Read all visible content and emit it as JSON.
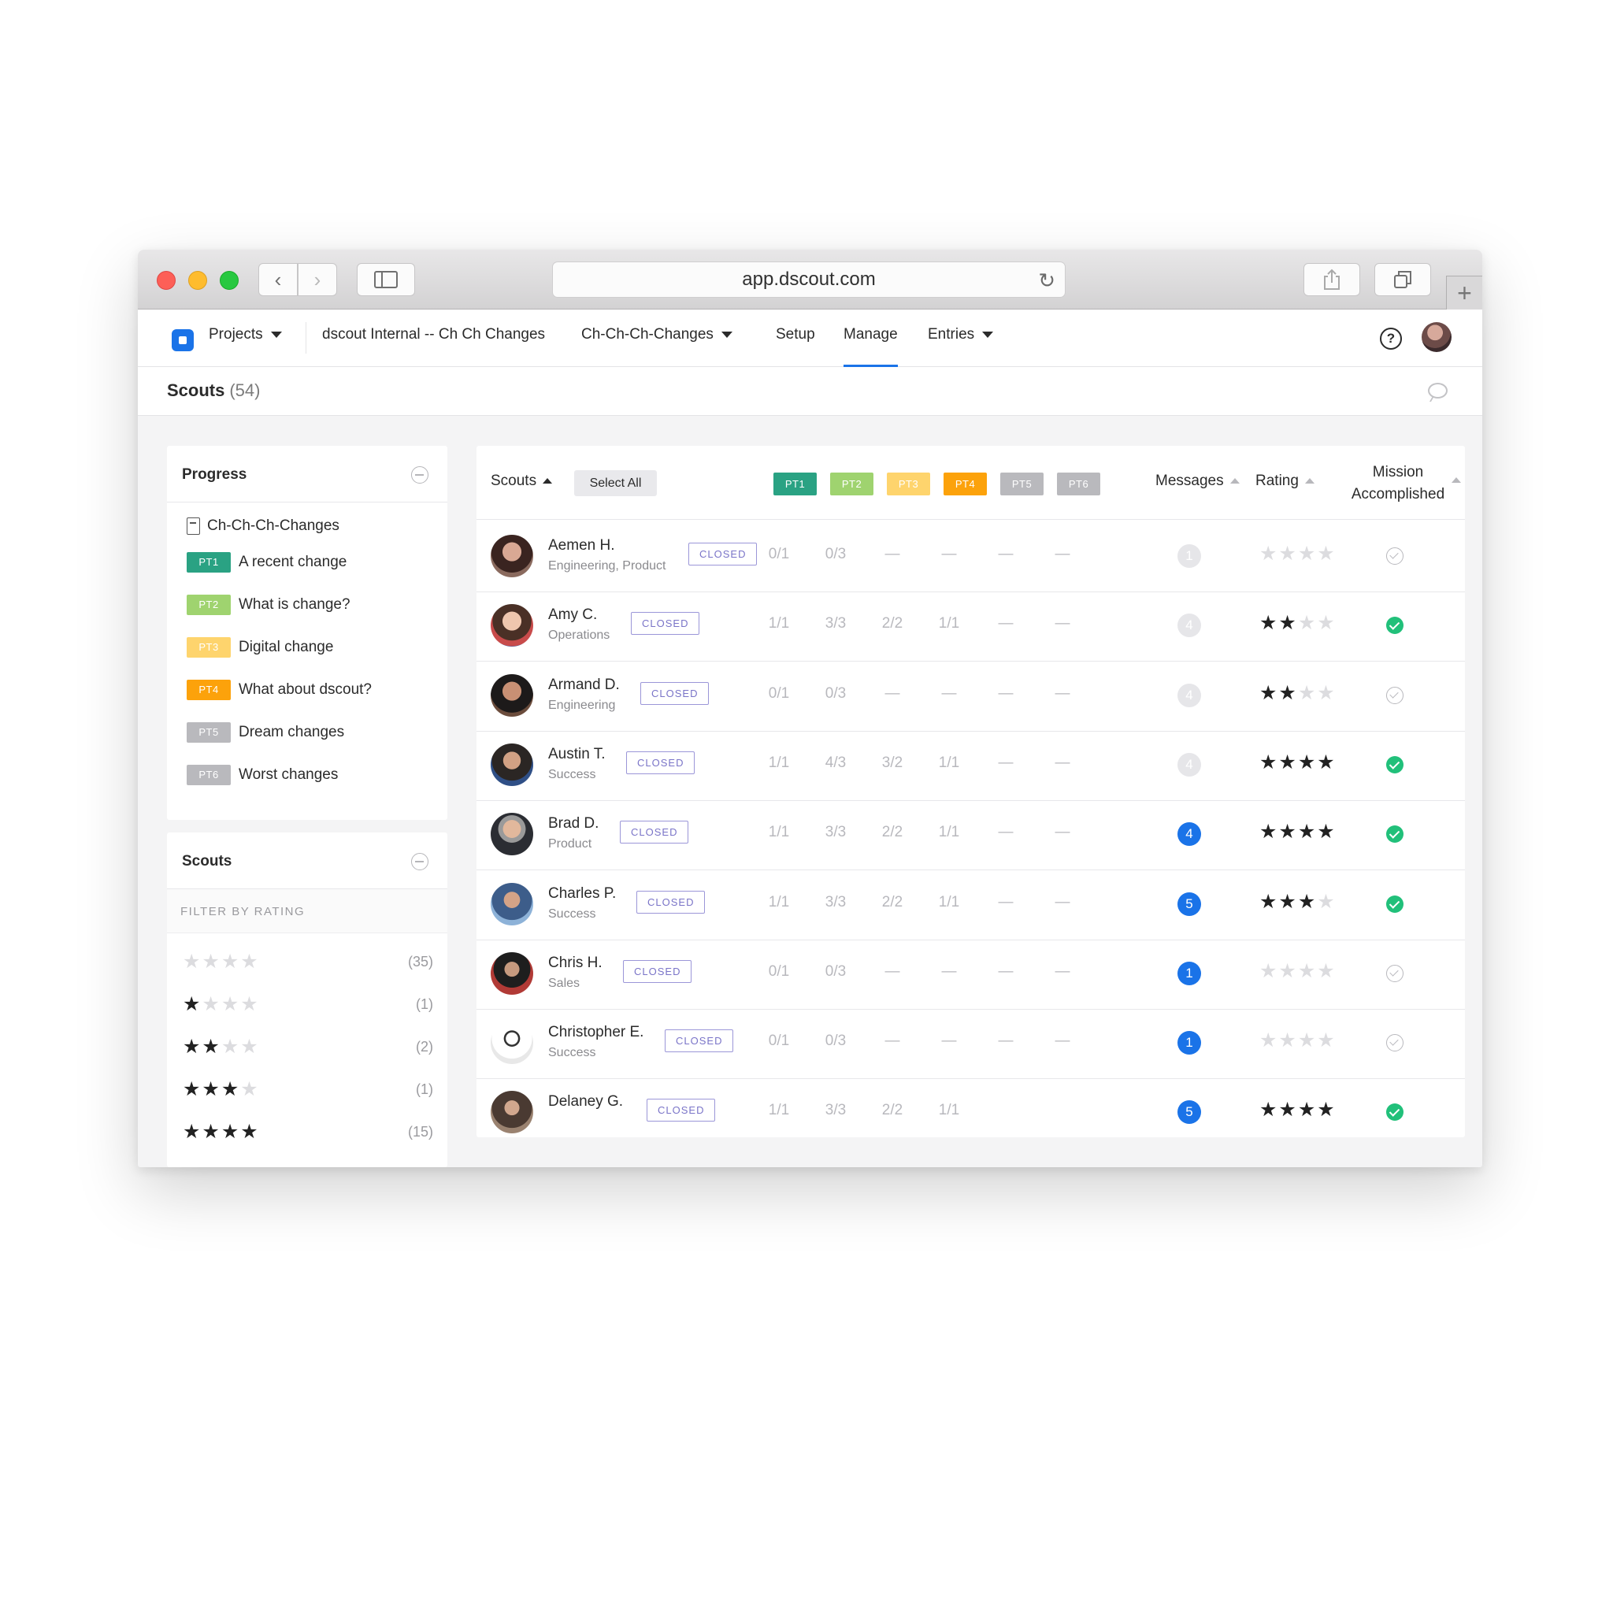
{
  "browser": {
    "url": "app.dscout.com"
  },
  "nav": {
    "projects": "Projects",
    "project_name": "dscout Internal -- Ch Ch Changes",
    "mission": "Ch-Ch-Ch-Changes",
    "setup": "Setup",
    "manage": "Manage",
    "entries": "Entries",
    "help": "?"
  },
  "page": {
    "title": "Scouts",
    "count": "(54)"
  },
  "progress": {
    "title": "Progress",
    "mission": "Ch-Ch-Ch-Changes",
    "parts": [
      {
        "tag": "PT1",
        "label": "A recent change",
        "color": "#2aa283"
      },
      {
        "tag": "PT2",
        "label": "What is change?",
        "color": "#9fd36f"
      },
      {
        "tag": "PT3",
        "label": "Digital change",
        "color": "#fed46d"
      },
      {
        "tag": "PT4",
        "label": "What about dscout?",
        "color": "#fca20b"
      },
      {
        "tag": "PT5",
        "label": "Dream changes",
        "color": "#b9b9bd"
      },
      {
        "tag": "PT6",
        "label": "Worst changes",
        "color": "#b9b9bd"
      }
    ]
  },
  "scout_filter": {
    "title": "Scouts",
    "filter_label": "FILTER BY RATING",
    "ratings": [
      {
        "stars": 0,
        "count": "(35)"
      },
      {
        "stars": 1,
        "count": "(1)"
      },
      {
        "stars": 2,
        "count": "(2)"
      },
      {
        "stars": 3,
        "count": "(1)"
      },
      {
        "stars": 4,
        "count": "(15)"
      }
    ]
  },
  "table": {
    "headers": {
      "scouts": "Scouts",
      "select_all": "Select All",
      "messages": "Messages",
      "rating": "Rating",
      "mission_1": "Mission",
      "mission_2": "Accomplished"
    },
    "rows": [
      {
        "name": "Aemen H.",
        "team": "Engineering, Product",
        "status": "CLOSED",
        "pt": [
          "0/1",
          "0/3",
          "—",
          "—",
          "—",
          "—"
        ],
        "messages": "1",
        "messages_read": true,
        "rating": 0,
        "accomplished": false
      },
      {
        "name": "Amy C.",
        "team": "Operations",
        "status": "CLOSED",
        "pt": [
          "1/1",
          "3/3",
          "2/2",
          "1/1",
          "—",
          "—"
        ],
        "messages": "4",
        "messages_read": true,
        "rating": 2,
        "accomplished": true
      },
      {
        "name": "Armand D.",
        "team": "Engineering",
        "status": "CLOSED",
        "pt": [
          "0/1",
          "0/3",
          "—",
          "—",
          "—",
          "—"
        ],
        "messages": "4",
        "messages_read": true,
        "rating": 2,
        "accomplished": false
      },
      {
        "name": "Austin T.",
        "team": "Success",
        "status": "CLOSED",
        "pt": [
          "1/1",
          "4/3",
          "3/2",
          "1/1",
          "—",
          "—"
        ],
        "messages": "4",
        "messages_read": true,
        "rating": 4,
        "accomplished": true
      },
      {
        "name": "Brad D.",
        "team": "Product",
        "status": "CLOSED",
        "pt": [
          "1/1",
          "3/3",
          "2/2",
          "1/1",
          "—",
          "—"
        ],
        "messages": "4",
        "messages_read": false,
        "rating": 4,
        "accomplished": true
      },
      {
        "name": "Charles P.",
        "team": "Success",
        "status": "CLOSED",
        "pt": [
          "1/1",
          "3/3",
          "2/2",
          "1/1",
          "—",
          "—"
        ],
        "messages": "5",
        "messages_read": false,
        "rating": 3,
        "accomplished": true
      },
      {
        "name": "Chris H.",
        "team": "Sales",
        "status": "CLOSED",
        "pt": [
          "0/1",
          "0/3",
          "—",
          "—",
          "—",
          "—"
        ],
        "messages": "1",
        "messages_read": false,
        "rating": 0,
        "accomplished": false
      },
      {
        "name": "Christopher E.",
        "team": "Success",
        "status": "CLOSED",
        "pt": [
          "0/1",
          "0/3",
          "—",
          "—",
          "—",
          "—"
        ],
        "messages": "1",
        "messages_read": false,
        "rating": 0,
        "accomplished": false
      },
      {
        "name": "Delaney G.",
        "team": "",
        "status": "CLOSED",
        "pt": [
          "1/1",
          "3/3",
          "2/2",
          "1/1",
          "",
          ""
        ],
        "messages": "5",
        "messages_read": false,
        "rating": 4,
        "accomplished": true
      }
    ]
  },
  "colors": {
    "accent": "#1a73e8",
    "closed_badge": "#7a74c8",
    "success": "#21c07a"
  },
  "icons": [
    "dscout-logo-icon",
    "back-icon",
    "forward-icon",
    "sidebar-icon",
    "reload-icon",
    "share-icon",
    "tabs-icon",
    "new-tab-icon",
    "help-icon",
    "chat-icon",
    "collapse-icon",
    "document-icon",
    "sort-up-icon",
    "star-icon",
    "check-circle-icon"
  ]
}
